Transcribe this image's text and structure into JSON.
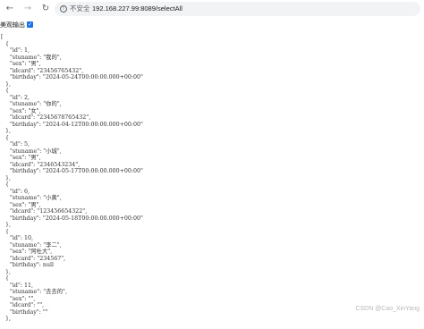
{
  "browser": {
    "security_text": "不安全",
    "url": "192.168.227.99:8089/selectAll",
    "back_icon": "←",
    "forward_icon": "→",
    "reload_icon": "↻"
  },
  "pretty_print": {
    "label": "美观输出",
    "checked": true
  },
  "records": [
    {
      "id": "1",
      "stuname": "我的",
      "sex": "男",
      "idcard": "23456765432",
      "birthday": "2024-05-24T00:00:00.000+00:00"
    },
    {
      "id": "2",
      "stuname": "你的",
      "sex": "女",
      "idcard": "2345678765432",
      "birthday": "2024-04-12T00:00:00.000+00:00"
    },
    {
      "id": "5",
      "stuname": "小城",
      "sex": "男",
      "idcard": "2346543234",
      "birthday": "2024-05-17T00:00:00.000+00:00"
    },
    {
      "id": "6",
      "stuname": "小黄",
      "sex": "男",
      "idcard": "123456654322",
      "birthday": "2024-05-18T00:00:00.000+00:00"
    },
    {
      "id": "10",
      "stuname": "李二",
      "sex": "阿杜大",
      "idcard": "234567",
      "birthday": "null"
    },
    {
      "id": "11",
      "stuname": "去去的",
      "sex": "",
      "idcard": "",
      "birthday": ""
    }
  ],
  "watermark": "CSDN @Cao_XinYang"
}
